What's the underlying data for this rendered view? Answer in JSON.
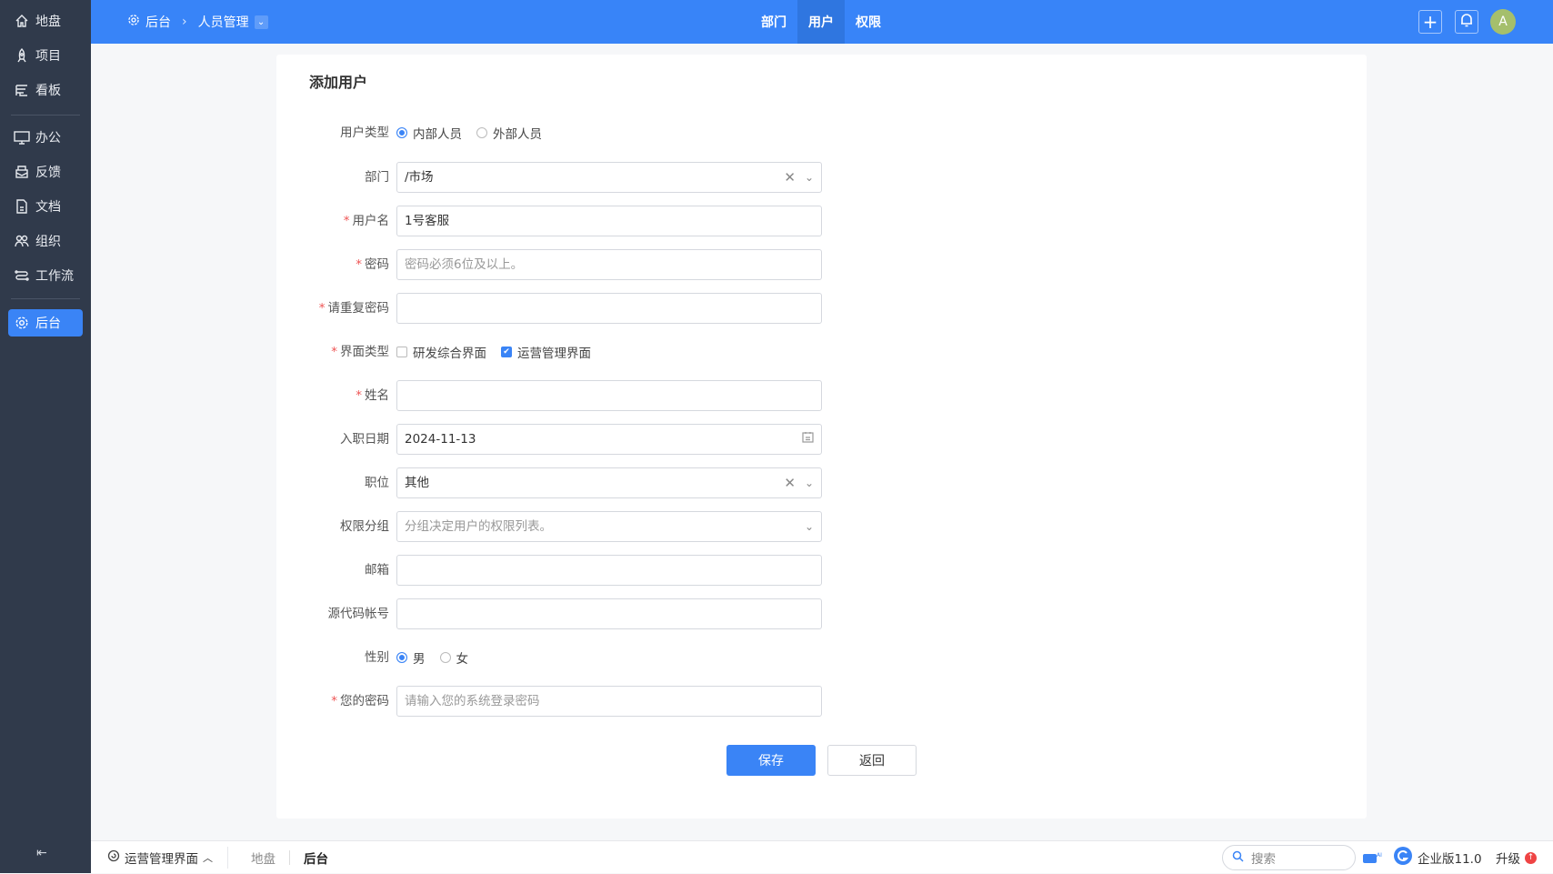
{
  "sidebar": {
    "items": [
      {
        "label": "地盘",
        "icon": "home-icon"
      },
      {
        "label": "项目",
        "icon": "rocket-icon"
      },
      {
        "label": "看板",
        "icon": "kanban-icon"
      },
      {
        "label": "办公",
        "icon": "oa-monitor-icon"
      },
      {
        "label": "反馈",
        "icon": "feedback-icon"
      },
      {
        "label": "文档",
        "icon": "document-icon"
      },
      {
        "label": "组织",
        "icon": "users-icon"
      },
      {
        "label": "工作流",
        "icon": "workflow-icon"
      },
      {
        "label": "后台",
        "icon": "gear-icon",
        "active": true
      }
    ]
  },
  "topbar": {
    "breadcrumb": [
      "后台",
      "人员管理"
    ],
    "tabs": [
      {
        "label": "部门"
      },
      {
        "label": "用户",
        "active": true
      },
      {
        "label": "权限"
      }
    ],
    "avatar": "A"
  },
  "form": {
    "title": "添加用户",
    "user_type": {
      "label": "用户类型",
      "options": [
        "内部人员",
        "外部人员"
      ],
      "selected": "内部人员"
    },
    "dept": {
      "label": "部门",
      "value": "/市场"
    },
    "username": {
      "label": "用户名",
      "value": "1号客服"
    },
    "password": {
      "label": "密码",
      "placeholder": "密码必须6位及以上。"
    },
    "repeat_password": {
      "label": "请重复密码"
    },
    "ui_type": {
      "label": "界面类型",
      "options": [
        "研发综合界面",
        "运营管理界面"
      ],
      "checked": [
        "运营管理界面"
      ]
    },
    "realname": {
      "label": "姓名"
    },
    "join_date": {
      "label": "入职日期",
      "value": "2024-11-13"
    },
    "role": {
      "label": "职位",
      "value": "其他"
    },
    "group": {
      "label": "权限分组",
      "placeholder": "分组决定用户的权限列表。"
    },
    "email": {
      "label": "邮箱"
    },
    "commiter": {
      "label": "源代码帐号"
    },
    "gender": {
      "label": "性别",
      "options": [
        "男",
        "女"
      ],
      "selected": "男"
    },
    "verify_password": {
      "label": "您的密码",
      "placeholder": "请输入您的系统登录密码"
    },
    "save": "保存",
    "back": "返回"
  },
  "footer": {
    "ui_switch": "运营管理界面",
    "crumbs": [
      "地盘",
      "后台"
    ],
    "search_placeholder": "搜索",
    "version": "企业版11.0",
    "upgrade": "升级"
  },
  "colors": {
    "accent": "#3884f8",
    "sidebar": "#303a4b",
    "required": "#e55555"
  }
}
